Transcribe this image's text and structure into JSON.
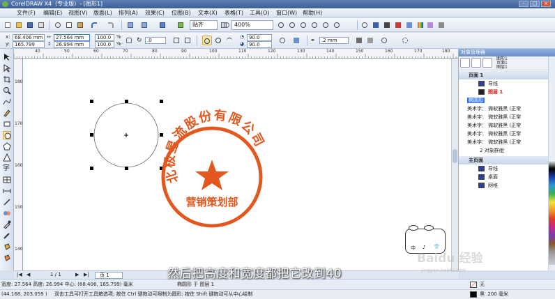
{
  "window": {
    "title": "CorelDRAW X4（专业版）- [图形1]",
    "buttons": [
      "-",
      "□",
      "×"
    ]
  },
  "menu": [
    "文件(F)",
    "编辑(E)",
    "视图(V)",
    "版面(L)",
    "排列(A)",
    "效果(C)",
    "位图(B)",
    "文本(X)",
    "表格(T)",
    "工具(O)",
    "窗口(W)",
    "帮助(H)"
  ],
  "toolbar": {
    "snap_label": "贴齐",
    "zoom_value": "400%"
  },
  "property_bar": {
    "x_label": "x:",
    "x_value": "68.406 mm",
    "y_label": "y:",
    "y_value": "165.799 mm",
    "w_value": "27.564 mm",
    "h_value": "26.994 mm",
    "scale_x": "100.0",
    "scale_y": "100.0",
    "scale_unit": "%",
    "rotation": ".0",
    "start_angle": "90.0",
    "end_angle": "90.0",
    "outline_width": ".2 mm"
  },
  "ruler": {
    "h_labels": [
      "40",
      "50",
      "60",
      "70",
      "80",
      "90",
      "100",
      "110",
      "120",
      "130",
      "140",
      "150",
      "160",
      "170",
      "180"
    ],
    "v_labels": [
      "180",
      "170",
      "160",
      "150",
      "140"
    ]
  },
  "stamp": {
    "arc_text": "北极星流股份有限公司",
    "bottom_text": "营销策划部",
    "color": "#e2581f"
  },
  "docker": {
    "title": "对象管理器",
    "top_info": [
      "图形1",
      "页面1",
      "图层1"
    ],
    "rows": [
      {
        "kind": "page",
        "text": "页面 1"
      },
      {
        "kind": "layer",
        "text": "导线",
        "color": "#2a3fa0"
      },
      {
        "kind": "layer-active",
        "text": "图层 1",
        "color": "#cc2222"
      },
      {
        "kind": "selected",
        "text": "椭圆形"
      },
      {
        "kind": "text",
        "text": "美术字： 微软雅黑 (正常"
      },
      {
        "kind": "text",
        "text": "美术字： 微软雅黑 (正常"
      },
      {
        "kind": "text",
        "text": "美术字： 微软雅黑 (正常"
      },
      {
        "kind": "text",
        "text": "美术字： 微软雅黑 (正常"
      },
      {
        "kind": "text",
        "text": "美术字： 微软雅黑 (正常"
      },
      {
        "kind": "group",
        "text": "2 对象群组"
      },
      {
        "kind": "page",
        "text": "主页面"
      },
      {
        "kind": "layer",
        "text": "导线",
        "color": "#2a3fa0"
      },
      {
        "kind": "layer",
        "text": "桌面",
        "color": "#2a3fa0"
      },
      {
        "kind": "layer",
        "text": "网格",
        "color": "#2a3fa0"
      }
    ]
  },
  "pagebar": {
    "page_counter": "1 / 1",
    "page_tab": "页 1"
  },
  "status": {
    "size": "宽度: 27.564  高度: 26.994  中心: (68.406, 165.799)  毫米",
    "object": "椭圆形 于 图层 1",
    "cursor": "(44.168, 203.059 )",
    "hint": "双击工具可打开工具箱选项; 按住 Ctrl 键拖动可限制为圆形; 按住 Shift 键拖动可从中心绘制",
    "fill": "无",
    "outline": "黑  .200 毫米"
  },
  "subtitle": "然后把高度和宽度都把它改到40",
  "watermark": {
    "main": "Baidu 经验",
    "sub": "jingyan.baidu.com"
  },
  "widget": {
    "labels": [
      "中",
      "♪",
      "👕"
    ]
  }
}
